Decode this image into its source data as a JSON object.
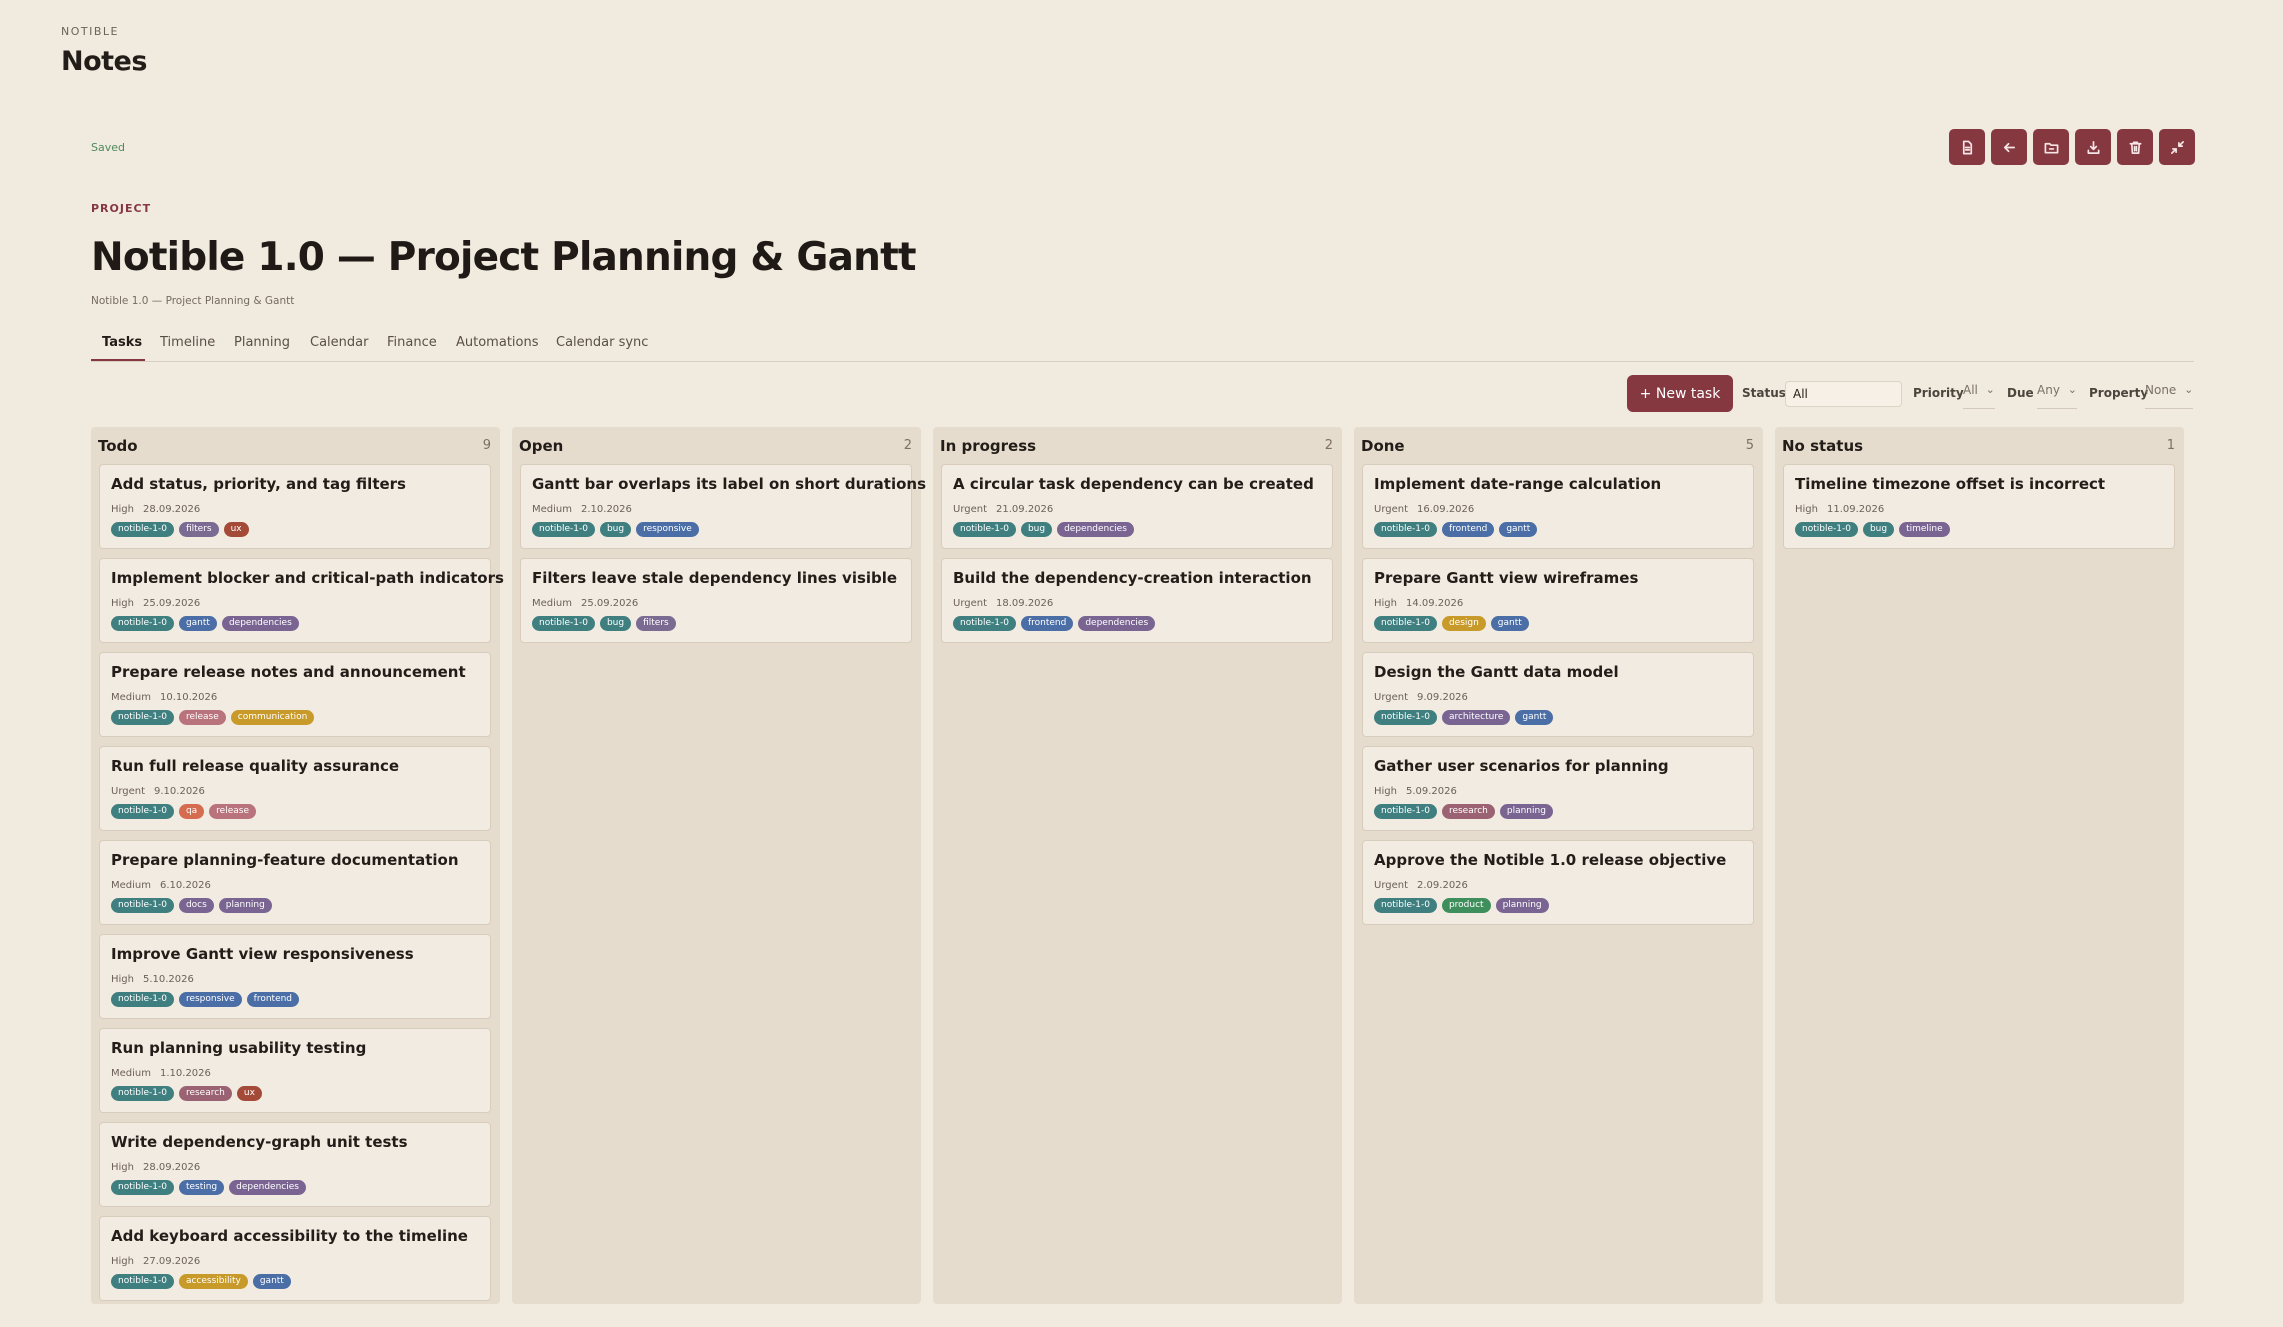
{
  "app": {
    "brand": "NOTIBLE",
    "title": "Notes"
  },
  "status_text": "Saved",
  "toolbar_icons": [
    "file-icon",
    "back-arrow-icon",
    "folder-icon",
    "download-icon",
    "trash-icon",
    "collapse-icon"
  ],
  "project": {
    "kicker": "PROJECT",
    "title": "Notible 1.0 — Project Planning & Gantt",
    "subtitle": "Notible 1.0 — Project Planning & Gantt"
  },
  "tabs": [
    {
      "label": "Tasks",
      "active": true
    },
    {
      "label": "Timeline"
    },
    {
      "label": "Planning"
    },
    {
      "label": "Calendar"
    },
    {
      "label": "Finance"
    },
    {
      "label": "Automations"
    },
    {
      "label": "Calendar sync"
    }
  ],
  "filters": {
    "new_task": "+ New task",
    "status_label": "Status",
    "status_value": "All",
    "priority_label": "Priority",
    "priority_value": "All",
    "due_label": "Due",
    "due_value": "Any",
    "property_label": "Property",
    "property_value": "None"
  },
  "tag_colors": {
    "notible-1-0": "#3f7f80",
    "filters": "#7b6a91",
    "ux": "#a44a38",
    "gantt": "#4a6ea5",
    "dependencies": "#7a6592",
    "release": "#b9737c",
    "communication": "#c89a2a",
    "qa": "#d56c4f",
    "docs": "#7a6592",
    "planning": "#7a6592",
    "responsive": "#4a6ea5",
    "frontend": "#4a6ea5",
    "research": "#9a6273",
    "testing": "#4a6ea5",
    "accessibility": "#c89a2a",
    "bug": "#3f7f80",
    "design": "#c89a2a",
    "architecture": "#7a6592",
    "product": "#3f8f5c",
    "timeline": "#7a6592"
  },
  "columns": [
    {
      "title": "Todo",
      "count": "9",
      "cards": [
        {
          "title": "Add status, priority, and tag filters",
          "priority": "High",
          "date": "28.09.2026",
          "tags": [
            "notible-1-0",
            "filters",
            "ux"
          ]
        },
        {
          "title": "Implement blocker and critical-path indicators",
          "priority": "High",
          "date": "25.09.2026",
          "tags": [
            "notible-1-0",
            "gantt",
            "dependencies"
          ]
        },
        {
          "title": "Prepare release notes and announcement",
          "priority": "Medium",
          "date": "10.10.2026",
          "tags": [
            "notible-1-0",
            "release",
            "communication"
          ]
        },
        {
          "title": "Run full release quality assurance",
          "priority": "Urgent",
          "date": "9.10.2026",
          "tags": [
            "notible-1-0",
            "qa",
            "release"
          ]
        },
        {
          "title": "Prepare planning-feature documentation",
          "priority": "Medium",
          "date": "6.10.2026",
          "tags": [
            "notible-1-0",
            "docs",
            "planning"
          ]
        },
        {
          "title": "Improve Gantt view responsiveness",
          "priority": "High",
          "date": "5.10.2026",
          "tags": [
            "notible-1-0",
            "responsive",
            "frontend"
          ]
        },
        {
          "title": "Run planning usability testing",
          "priority": "Medium",
          "date": "1.10.2026",
          "tags": [
            "notible-1-0",
            "research",
            "ux"
          ]
        },
        {
          "title": "Write dependency-graph unit tests",
          "priority": "High",
          "date": "28.09.2026",
          "tags": [
            "notible-1-0",
            "testing",
            "dependencies"
          ]
        },
        {
          "title": "Add keyboard accessibility to the timeline",
          "priority": "High",
          "date": "27.09.2026",
          "tags": [
            "notible-1-0",
            "accessibility",
            "gantt"
          ]
        }
      ]
    },
    {
      "title": "Open",
      "count": "2",
      "cards": [
        {
          "title": "Gantt bar overlaps its label on short durations",
          "priority": "Medium",
          "date": "2.10.2026",
          "tags": [
            "notible-1-0",
            "bug",
            "responsive"
          ]
        },
        {
          "title": "Filters leave stale dependency lines visible",
          "priority": "Medium",
          "date": "25.09.2026",
          "tags": [
            "notible-1-0",
            "bug",
            "filters"
          ]
        }
      ]
    },
    {
      "title": "In progress",
      "count": "2",
      "cards": [
        {
          "title": "A circular task dependency can be created",
          "priority": "Urgent",
          "date": "21.09.2026",
          "tags": [
            "notible-1-0",
            "bug",
            "dependencies"
          ]
        },
        {
          "title": "Build the dependency-creation interaction",
          "priority": "Urgent",
          "date": "18.09.2026",
          "tags": [
            "notible-1-0",
            "frontend",
            "dependencies"
          ]
        }
      ]
    },
    {
      "title": "Done",
      "count": "5",
      "cards": [
        {
          "title": "Implement date-range calculation",
          "priority": "Urgent",
          "date": "16.09.2026",
          "tags": [
            "notible-1-0",
            "frontend",
            "gantt"
          ]
        },
        {
          "title": "Prepare Gantt view wireframes",
          "priority": "High",
          "date": "14.09.2026",
          "tags": [
            "notible-1-0",
            "design",
            "gantt"
          ]
        },
        {
          "title": "Design the Gantt data model",
          "priority": "Urgent",
          "date": "9.09.2026",
          "tags": [
            "notible-1-0",
            "architecture",
            "gantt"
          ]
        },
        {
          "title": "Gather user scenarios for planning",
          "priority": "High",
          "date": "5.09.2026",
          "tags": [
            "notible-1-0",
            "research",
            "planning"
          ]
        },
        {
          "title": "Approve the Notible 1.0 release objective",
          "priority": "Urgent",
          "date": "2.09.2026",
          "tags": [
            "notible-1-0",
            "product",
            "planning"
          ]
        }
      ]
    },
    {
      "title": "No status",
      "count": "1",
      "cards": [
        {
          "title": "Timeline timezone offset is incorrect",
          "priority": "High",
          "date": "11.09.2026",
          "tags": [
            "notible-1-0",
            "bug",
            "timeline"
          ]
        }
      ]
    }
  ]
}
